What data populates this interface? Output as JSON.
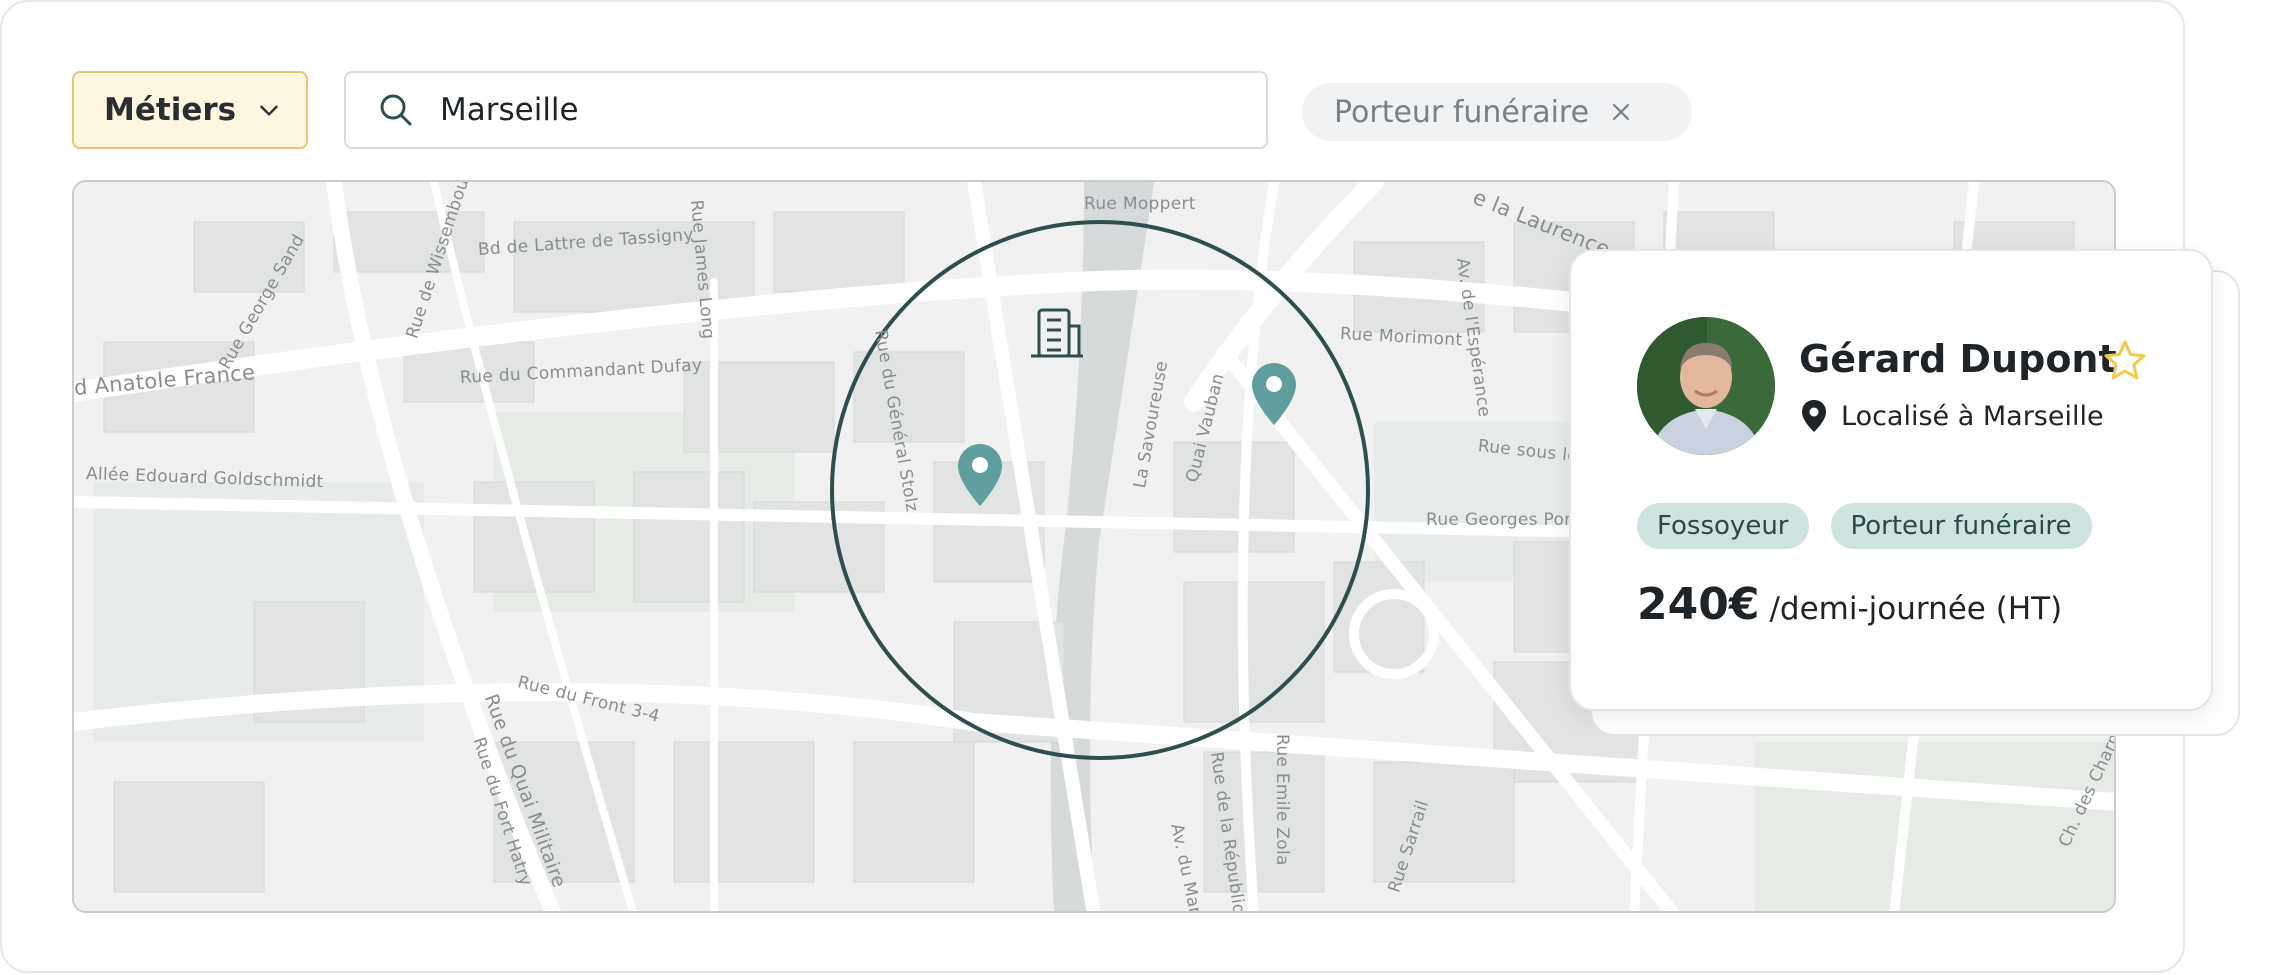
{
  "filters": {
    "metiers_label": "Métiers",
    "search_value": "Marseille",
    "active_chip": "Porteur funéraire"
  },
  "map": {
    "streets": [
      "Rue Moppert",
      "Bd de Lattre de Tassigny",
      "Rue du Commandant Dufay",
      "d Anatole France",
      "Allée Edouard Goldschmidt",
      "Rue du Général Stolz",
      "La Savoureuse",
      "Quai Vauban",
      "Rue Morimont",
      "Rue Georges Pom",
      "Rue sous le",
      "e la Laurence",
      "Av. de l'Espérance",
      "Rue du Front 3-4",
      "Rue du Quai Militaire",
      "Rue du Fort Hatry",
      "Rue Emile Zola",
      "Rue de la République",
      "Av. du Maréchal",
      "Rue de Wissembourg",
      "Rue George Sand",
      "Rue James Long",
      "Rue Sarrail",
      "Ch. des Charm"
    ]
  },
  "profile": {
    "name": "Gérard Dupont",
    "location": "Localisé à Marseille",
    "tags": [
      "Fossoyeur",
      "Porteur funéraire"
    ],
    "price": "240€",
    "price_unit": "/demi-journée (HT)"
  },
  "colors": {
    "accent_teal": "#5f9e9c",
    "circle_stroke": "#2f4f4f",
    "metiers_bg": "#fdf6e1",
    "metiers_border": "#e4c57a",
    "star": "#f2c94c",
    "tag_bg": "#cfe3e1"
  }
}
